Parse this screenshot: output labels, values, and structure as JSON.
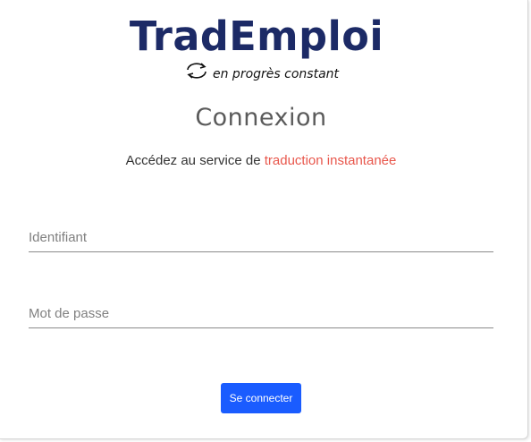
{
  "logo": {
    "brand": "TradEmploi",
    "tagline": "en progrès constant",
    "icon": "refresh-cycle-icon",
    "brand_color": "#1c2a66"
  },
  "login": {
    "title": "Connexion",
    "subtitle_prefix": "Accédez au service de ",
    "subtitle_highlight": "traduction instantanée",
    "highlight_color": "#e8574c",
    "username_placeholder": "Identifiant",
    "username_value": "",
    "password_placeholder": "Mot de passe",
    "password_value": "",
    "submit_label": "Se connecter",
    "button_color": "#1a5cff"
  }
}
